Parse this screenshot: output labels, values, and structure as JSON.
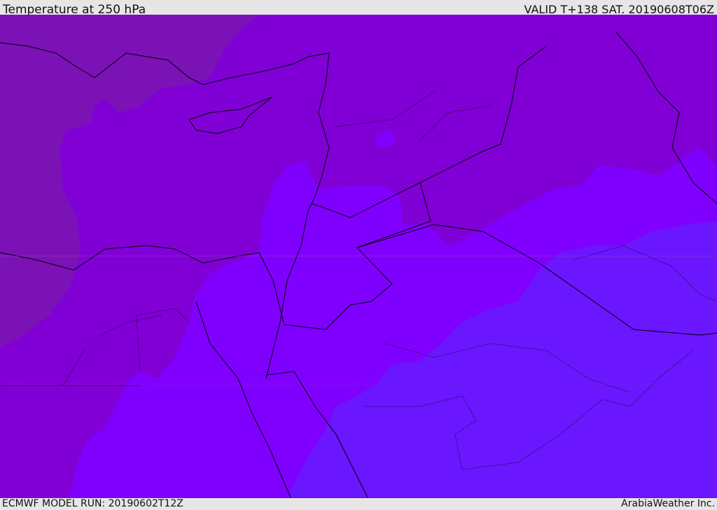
{
  "header": {
    "title": "Temperature at 250 hPa",
    "valid": "VALID T+138 SAT. 20190608T06Z"
  },
  "footer": {
    "model_run": "ECMWF MODEL RUN: 20190602T12Z",
    "brand": "ArabiaWeather Inc."
  },
  "colors": {
    "zone_coldest": "#7b12b6",
    "zone_cold": "#8000d6",
    "zone_mid": "#8000ff",
    "zone_warm": "#6a16ff",
    "coast": "#000000"
  }
}
